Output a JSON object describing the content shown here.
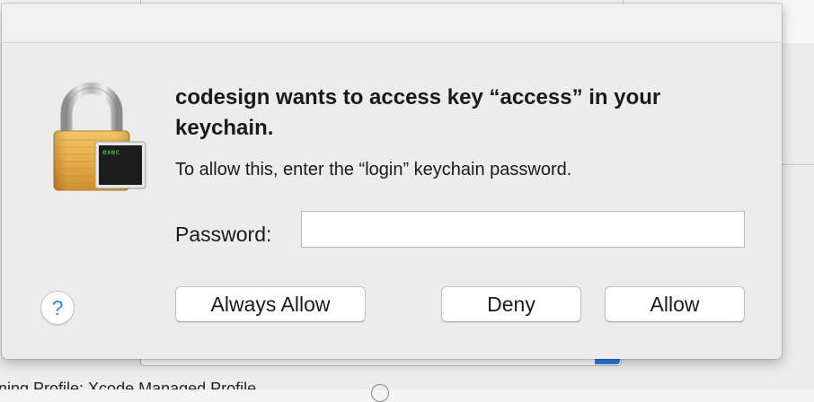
{
  "dialog": {
    "title": "codesign wants to access key “access” in your keychain.",
    "subtitle": "To allow this, enter the “login” keychain password.",
    "password_label": "Password:",
    "password_value": "",
    "help_label": "?",
    "buttons": {
      "always_allow": "Always Allow",
      "deny": "Deny",
      "allow": "Allow"
    },
    "lock_icon": {
      "icon": "lock-terminal-icon",
      "terminal_text": "exec"
    }
  },
  "background": {
    "bottom_text": "ning Profile: Xcode Managed Profile"
  },
  "colors": {
    "accent": "#3a82f7",
    "dialog_bg": "#ececec",
    "lock_gold": "#e4a63a"
  }
}
